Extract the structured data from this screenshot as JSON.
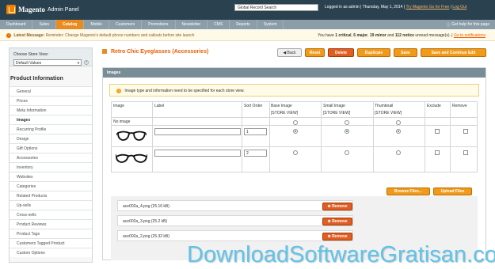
{
  "header": {
    "logo": "Magento",
    "admin": "Admin Panel",
    "search_value": "Global Record Search",
    "logged_in": "Logged in as admin",
    "date": "Thursday, May 1, 2014",
    "go_free": "Try Magento Go for Free",
    "logout": "Log Out"
  },
  "nav": {
    "items": [
      "Dashboard",
      "Sales",
      "Catalog",
      "Mobile",
      "Customers",
      "Promotions",
      "Newsletter",
      "CMS",
      "Reports",
      "System"
    ],
    "help": "Get help for this page"
  },
  "notice": {
    "label": "Latest Message:",
    "message": "Reminder: Change Magento's default phone numbers and callouts before site launch",
    "summary_prefix": "You have",
    "critical": "1 critical",
    "major": "6 major",
    "minor": "19 minor",
    "notice": "112 notice",
    "summary_suffix": "unread message(s).",
    "link": "Go to notifications"
  },
  "sidebar": {
    "store_label": "Choose Store View:",
    "store_value": "Default Values",
    "title": "Product Information",
    "tabs": [
      "General",
      "Prices",
      "Meta Information",
      "Images",
      "Recurring Profile",
      "Design",
      "Gift Options",
      "Accessories",
      "Inventory",
      "Websites",
      "Categories",
      "Related Products",
      "Up-sells",
      "Cross-sells",
      "Product Reviews",
      "Product Tags",
      "Customers Tagged Product",
      "Custom Options"
    ]
  },
  "page": {
    "title": "Retro Chic Eyeglasses (Accessories)",
    "buttons": [
      "Back",
      "Reset",
      "Delete",
      "Duplicate",
      "Save",
      "Save and Continue Edit"
    ]
  },
  "images": {
    "header": "Images",
    "note": "Image type and information need to be specified for each store view.",
    "columns": [
      "Image",
      "Label",
      "Sort Order",
      "Base Image",
      "Small Image",
      "Thumbnail",
      "Exclude",
      "Remove"
    ],
    "store_view": "[STORE VIEW]",
    "no_image": "No image",
    "rows": [
      {
        "sort": "1"
      },
      {
        "sort": "2"
      }
    ],
    "browse": "Browse Files...",
    "upload": "Upload Files",
    "files": [
      "ace002a_4.png (25.16 kB)",
      "ace002a_3.png (25.2 kB)",
      "ace002a_2.png (25.32 kB)"
    ],
    "remove": "Remove"
  },
  "watermark": "DownloadSoftwareGratisan.com"
}
